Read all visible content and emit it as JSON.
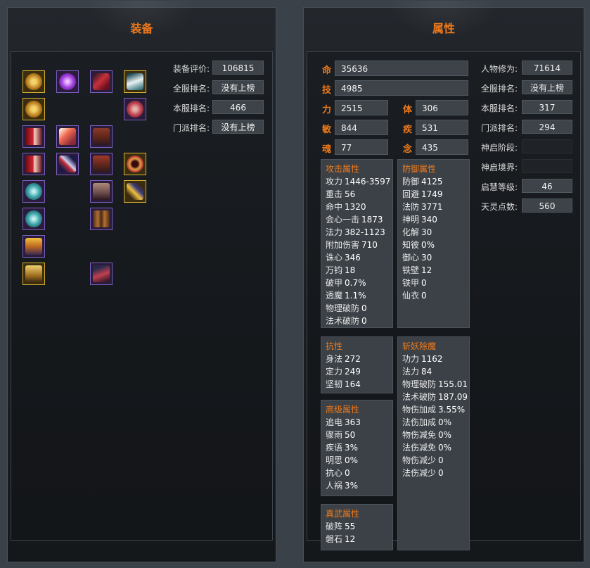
{
  "equipment": {
    "title": "装备",
    "rating_label": "装备评价:",
    "rating_value": "106815",
    "server_all_label": "全服排名:",
    "server_all_value": "没有上榜",
    "server_local_label": "本服排名:",
    "server_local_value": "466",
    "school_label": "门派排名:",
    "school_value": "没有上榜",
    "slots": [
      {
        "icon": "gold-disc-icon",
        "frame": "gold"
      },
      {
        "icon": "purple-orb-icon",
        "frame": "purple"
      },
      {
        "icon": "red-scarf-icon",
        "frame": "purple"
      },
      {
        "icon": "white-crane-icon",
        "frame": "gold"
      },
      {
        "icon": "gold-disc-icon",
        "frame": "gold"
      },
      {
        "icon": "beast-mask-icon",
        "frame": "purple"
      },
      {
        "icon": "red-crest-icon",
        "frame": "purple"
      },
      {
        "icon": "flame-burst-icon",
        "frame": "purple"
      },
      {
        "icon": "armor-icon",
        "frame": "purple"
      },
      {
        "icon": "red-crest-icon",
        "frame": "purple"
      },
      {
        "icon": "staff-icon",
        "frame": "purple"
      },
      {
        "icon": "armor-icon",
        "frame": "purple"
      },
      {
        "icon": "gold-ring-icon",
        "frame": "gold"
      },
      {
        "icon": "jade-orb-icon",
        "frame": "purple"
      },
      {
        "icon": "robe-icon",
        "frame": "purple"
      },
      {
        "icon": "gold-scroll-icon",
        "frame": "gold"
      },
      {
        "icon": "jade-orb-icon",
        "frame": "purple"
      },
      {
        "icon": "trousers-icon",
        "frame": "purple"
      },
      {
        "icon": "gold-crown-icon",
        "frame": "purple"
      },
      {
        "icon": "gold-tablet-icon",
        "frame": "gold"
      },
      {
        "icon": "boot-icon",
        "frame": "purple"
      }
    ]
  },
  "attributes": {
    "title": "属性",
    "ming_label": "命",
    "ming_value": "35636",
    "ji_label": "技",
    "ji_value": "4985",
    "li_label": "力",
    "li_value": "2515",
    "ti_label": "体",
    "ti_value": "306",
    "min_label": "敏",
    "min_value": "844",
    "ji2_label": "疾",
    "ji2_value": "531",
    "hun_label": "魂",
    "hun_value": "77",
    "nian_label": "念",
    "nian_value": "435",
    "attack": {
      "title": "攻击属性",
      "rows": [
        {
          "k": "攻力",
          "v": "1446-3597"
        },
        {
          "k": "重击",
          "v": "56"
        },
        {
          "k": "命中",
          "v": "1320"
        },
        {
          "k": "会心一击",
          "v": "1873"
        },
        {
          "k": "法力",
          "v": "382-1123"
        },
        {
          "k": "附加伤害",
          "v": "710"
        },
        {
          "k": "诛心",
          "v": "346"
        },
        {
          "k": "万钧",
          "v": "18"
        },
        {
          "k": "破甲",
          "v": "0.7%"
        },
        {
          "k": "透魔",
          "v": "1.1%"
        },
        {
          "k": "物理破防",
          "v": "0"
        },
        {
          "k": "法术破防",
          "v": "0"
        }
      ]
    },
    "defense": {
      "title": "防御属性",
      "rows": [
        {
          "k": "防御",
          "v": "4125"
        },
        {
          "k": "回避",
          "v": "1749"
        },
        {
          "k": "法防",
          "v": "3771"
        },
        {
          "k": "神明",
          "v": "340"
        },
        {
          "k": "化解",
          "v": "30"
        },
        {
          "k": "知彼",
          "v": "0%"
        },
        {
          "k": "御心",
          "v": "30"
        },
        {
          "k": "铁壁",
          "v": "12"
        },
        {
          "k": "铁甲",
          "v": "0"
        },
        {
          "k": "仙衣",
          "v": "0"
        }
      ]
    },
    "resist": {
      "title": "抗性",
      "rows": [
        {
          "k": "身法",
          "v": "272"
        },
        {
          "k": "定力",
          "v": "249"
        },
        {
          "k": "坚韧",
          "v": "164"
        }
      ]
    },
    "advanced": {
      "title": "高级属性",
      "rows": [
        {
          "k": "追电",
          "v": "363"
        },
        {
          "k": "骤雨",
          "v": "50"
        },
        {
          "k": "疾语",
          "v": "3%"
        },
        {
          "k": "明思",
          "v": "0%"
        },
        {
          "k": "抗心",
          "v": "0"
        },
        {
          "k": "人祸",
          "v": "3%"
        }
      ]
    },
    "zhenwu": {
      "title": "真武属性",
      "rows": [
        {
          "k": "破阵",
          "v": "55"
        },
        {
          "k": "磐石",
          "v": "12"
        }
      ]
    },
    "demon": {
      "title": "斩妖除魔",
      "rows": [
        {
          "k": "功力",
          "v": "1162"
        },
        {
          "k": "法力",
          "v": "84"
        },
        {
          "k": "物理破防",
          "v": "155.01"
        },
        {
          "k": "法术破防",
          "v": "187.09"
        },
        {
          "k": "物伤加成",
          "v": "3.55%"
        },
        {
          "k": "法伤加成",
          "v": "0%"
        },
        {
          "k": "物伤减免",
          "v": "0%"
        },
        {
          "k": "法伤减免",
          "v": "0%"
        },
        {
          "k": "物伤减少",
          "v": "0"
        },
        {
          "k": "法伤减少",
          "v": "0"
        }
      ]
    },
    "side": {
      "cultivation_label": "人物修为:",
      "cultivation_value": "71614",
      "all_rank_label": "全服排名:",
      "all_rank_value": "没有上榜",
      "local_rank_label": "本服排名:",
      "local_rank_value": "317",
      "school_rank_label": "门派排名:",
      "school_rank_value": "294",
      "shenqi_stage_label": "神启阶段:",
      "shenqi_stage_value": "",
      "shenqi_realm_label": "神启境界:",
      "shenqi_realm_value": "",
      "wisdom_label": "启慧等级:",
      "wisdom_value": "46",
      "tianling_label": "天灵点数:",
      "tianling_value": "560"
    }
  }
}
